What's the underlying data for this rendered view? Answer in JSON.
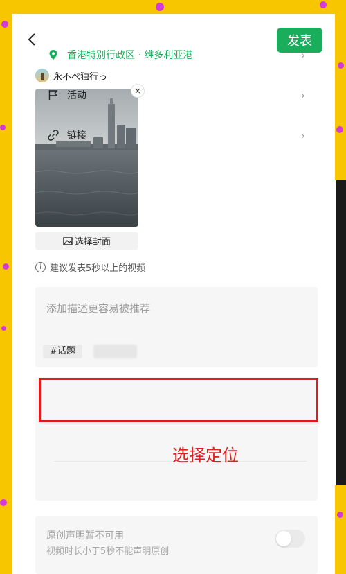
{
  "header": {
    "publish_label": "发表"
  },
  "user": {
    "name": "永不ぺ独行っ"
  },
  "video": {
    "cover_button_label": "选择封面",
    "close_symbol": "×"
  },
  "tip": {
    "text": "建议发表5秒以上的视频",
    "icon_symbol": "i"
  },
  "description": {
    "placeholder": "添加描述更容易被推荐",
    "topic_button_label": "#话题"
  },
  "options": [
    {
      "label": "香港特别行政区 · 维多利亚港",
      "icon": "location-pin-icon",
      "chevron": "›"
    },
    {
      "label": "活动",
      "icon": "flag-icon",
      "chevron": "›"
    },
    {
      "label": "链接",
      "icon": "link-icon",
      "chevron": "›"
    }
  ],
  "annotation": {
    "text": "选择定位"
  },
  "original": {
    "title": "原创声明暂不可用",
    "subtitle": "视频时长小于5秒不能声明原创"
  },
  "colors": {
    "accent": "#1aad5b",
    "annotation_red": "#e01b1b",
    "background": "#f7c600",
    "dots": "#d43ad9"
  }
}
